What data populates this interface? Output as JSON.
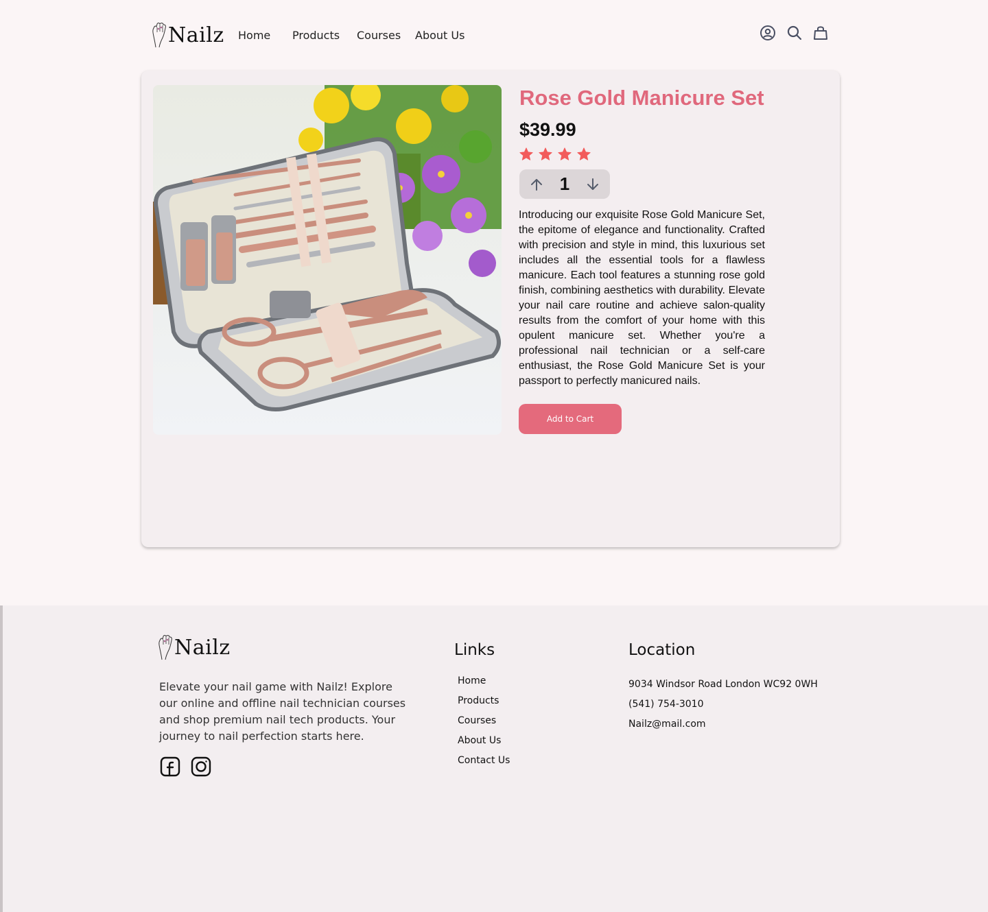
{
  "brand": {
    "name": "Nailz"
  },
  "nav": {
    "items": [
      "Home",
      "Products",
      "Courses",
      "About Us"
    ]
  },
  "header_icons": [
    "user-icon",
    "search-icon",
    "shopping-bag-icon"
  ],
  "product": {
    "title": "Rose Gold Manicure Set",
    "price": "$39.99",
    "rating": 4,
    "quantity": "1",
    "description": "Introducing our exquisite Rose Gold Manicure Set, the epitome of elegance and functionality. Crafted with precision and style in mind, this luxurious set includes all the essential tools for a flawless manicure. Each tool features a stunning rose gold finish, combining aesthetics with durability. Elevate your nail care routine and achieve salon-quality results from the comfort of your home with this opulent manicure set. Whether you're a professional nail technician or a self-care enthusiast, the Rose Gold Manicure Set is your passport to perfectly manicured nails.",
    "add_to_cart_label": "Add to Cart"
  },
  "footer": {
    "tagline": "Elevate your nail game with Nailz! Explore our online and offline nail technician courses and shop premium nail tech products. Your journey to nail perfection starts here.",
    "social": [
      "facebook-icon",
      "instagram-icon"
    ],
    "links_title": "Links",
    "links": [
      "Home",
      "Products",
      "Courses",
      "About Us",
      "Contact Us"
    ],
    "location_title": "Location",
    "address": "9034 Windsor Road London WC92 0WH",
    "phone": "(541) 754-3010",
    "email": "Nailz@mail.com"
  },
  "colors": {
    "accent": "#e0687c",
    "button": "#e46a7c",
    "page_bg": "#fbf5f6",
    "card_bg": "#f4eef0",
    "star": "#f25b5b"
  }
}
